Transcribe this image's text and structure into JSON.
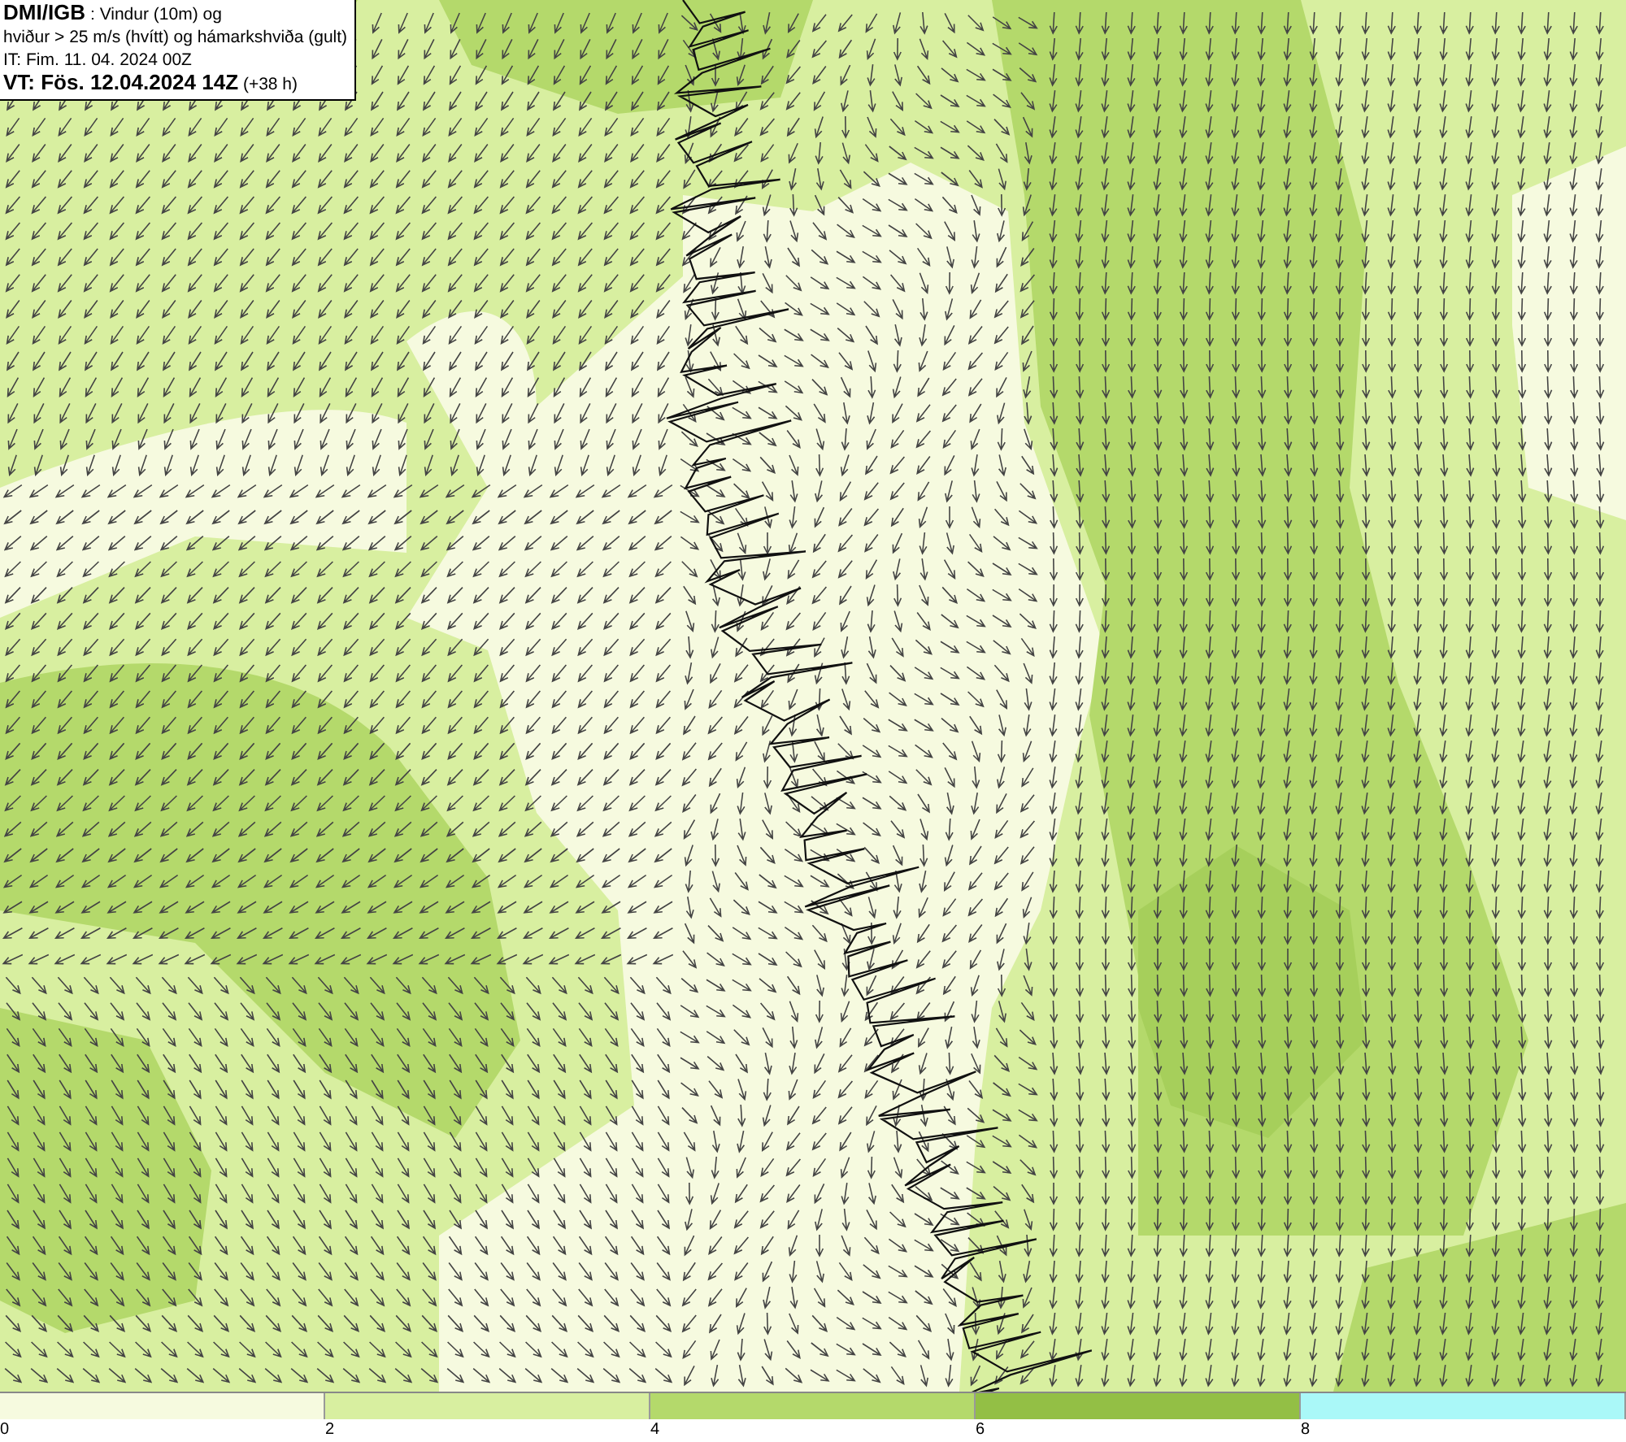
{
  "title_box": {
    "lines": [
      "**DMI/IGB** : Vindur (10m) og",
      "hviður > 25 m/s (hvítt) og hámarkshviða (gult)",
      "IT: Fim. 11. 04. 2024 00Z",
      "**VT: Fös. 12.04.2024 14Z** (+38 h)"
    ]
  },
  "legend": {
    "bins": [
      {
        "color": "#f6fadf",
        "label": "0"
      },
      {
        "color": "#d8efa0",
        "label": "2"
      },
      {
        "color": "#b4d96b",
        "label": "4"
      },
      {
        "color": "#93bf45",
        "label": "6"
      },
      {
        "color": "#aaf8f8",
        "label": "8"
      }
    ]
  }
}
